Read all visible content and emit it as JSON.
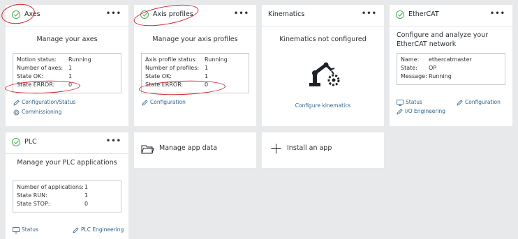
{
  "cards": {
    "axes": {
      "title": "Axes",
      "subtitle": "Manage your axes",
      "rows": [
        {
          "k": "Motion status:",
          "v": "Running"
        },
        {
          "k": "Number of axes:",
          "v": "1"
        },
        {
          "k": "State OK:",
          "v": "1"
        },
        {
          "k": "State ERROR:",
          "v": "0"
        }
      ],
      "links": [
        "Configuration/Status",
        "Commissioning"
      ]
    },
    "axis_profiles": {
      "title": "Axis profiles",
      "subtitle": "Manage your axis profiles",
      "rows": [
        {
          "k": "Axis profile status:",
          "v": "Running"
        },
        {
          "k": "Number of profiles:",
          "v": "1"
        },
        {
          "k": "State OK:",
          "v": "1"
        },
        {
          "k": "State ERROR:",
          "v": "0"
        }
      ],
      "links": [
        "Configuration"
      ]
    },
    "kinematics": {
      "title": "Kinematics",
      "subtitle": "Kinematics not configured",
      "link": "Configure kinematics"
    },
    "ethercat": {
      "title": "EtherCAT",
      "subtitle": "Configure and analyze your EtherCAT network",
      "rows": [
        {
          "k": "Name:",
          "v": "ethercatmaster"
        },
        {
          "k": "State:",
          "v": "OP"
        },
        {
          "k": "Message:",
          "v": "Running"
        }
      ],
      "links": [
        "Status",
        "Configuration",
        "I/O Engineering"
      ]
    },
    "plc": {
      "title": "PLC",
      "subtitle": "Manage your PLC applications",
      "rows": [
        {
          "k": "Number of applications:",
          "v": "1"
        },
        {
          "k": "State RUN:",
          "v": "1"
        },
        {
          "k": "State STOP:",
          "v": "0"
        }
      ],
      "links": [
        "Status",
        "PLC Engineering"
      ]
    },
    "manage_app_data": {
      "label": "Manage app data"
    },
    "install_app": {
      "label": "Install an app"
    }
  },
  "more_glyph": "•••",
  "colors": {
    "ok": "#4caf50",
    "annotation": "#d7232f",
    "link": "#2c5f8a",
    "background": "#e8e9eb"
  }
}
